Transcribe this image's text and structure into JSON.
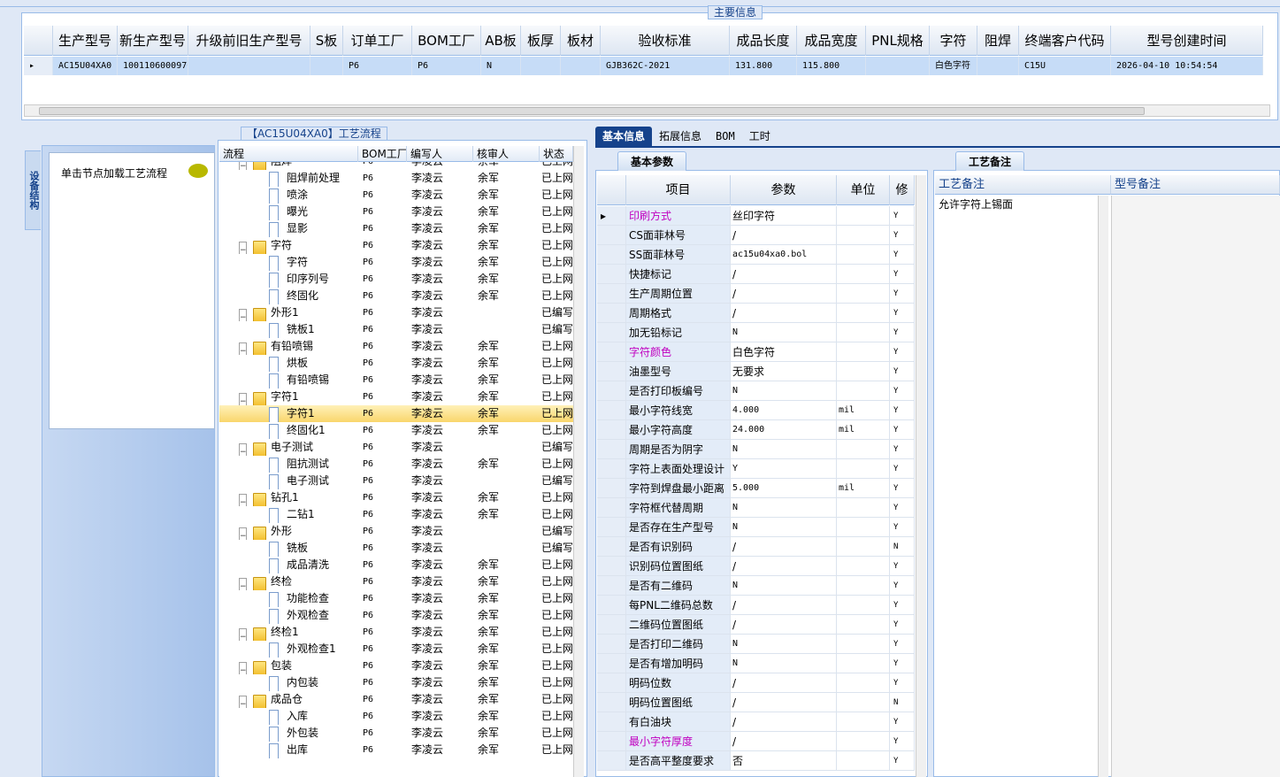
{
  "top": {
    "group_title": "主要信息",
    "columns": [
      "",
      "生产型号",
      "新生产型号",
      "升级前旧生产型号",
      "S板",
      "订单工厂",
      "BOM工厂",
      "AB板",
      "板厚",
      "板材",
      "验收标准",
      "成品长度",
      "成品宽度",
      "PNL规格",
      "字符",
      "阻焊",
      "终端客户代码",
      "型号创建时间"
    ],
    "row": [
      "",
      "AC15U04XA0",
      "10011060009702",
      "",
      "",
      "P6",
      "P6",
      "N",
      "",
      "",
      "GJB362C-2021",
      "131.800",
      "115.800",
      "",
      "白色字符",
      "",
      "C15U",
      "2026-04-10 10:54:54"
    ]
  },
  "left": {
    "vertical_tab": "设备结构",
    "hint": "单击节点加载工艺流程"
  },
  "flow": {
    "title": "【AC15U04XA0】工艺流程",
    "columns": [
      "流程",
      "BOM工厂",
      "编写人",
      "核审人",
      "状态"
    ],
    "rows": [
      {
        "name": "阻焊",
        "type": "folder",
        "level": 1,
        "bom": "P6",
        "author": "李凌云",
        "reviewer": "余军",
        "status": "已上网"
      },
      {
        "name": "阻焊前处理",
        "type": "page",
        "level": 2,
        "bom": "P6",
        "author": "李凌云",
        "reviewer": "余军",
        "status": "已上网"
      },
      {
        "name": "喷涂",
        "type": "page",
        "level": 2,
        "bom": "P6",
        "author": "李凌云",
        "reviewer": "余军",
        "status": "已上网"
      },
      {
        "name": "曝光",
        "type": "page",
        "level": 2,
        "bom": "P6",
        "author": "李凌云",
        "reviewer": "余军",
        "status": "已上网"
      },
      {
        "name": "显影",
        "type": "page",
        "level": 2,
        "bom": "P6",
        "author": "李凌云",
        "reviewer": "余军",
        "status": "已上网"
      },
      {
        "name": "字符",
        "type": "folder",
        "level": 1,
        "bom": "P6",
        "author": "李凌云",
        "reviewer": "余军",
        "status": "已上网"
      },
      {
        "name": "字符",
        "type": "page",
        "level": 2,
        "bom": "P6",
        "author": "李凌云",
        "reviewer": "余军",
        "status": "已上网"
      },
      {
        "name": "印序列号",
        "type": "page",
        "level": 2,
        "bom": "P6",
        "author": "李凌云",
        "reviewer": "余军",
        "status": "已上网"
      },
      {
        "name": "终固化",
        "type": "page",
        "level": 2,
        "bom": "P6",
        "author": "李凌云",
        "reviewer": "余军",
        "status": "已上网"
      },
      {
        "name": "外形1",
        "type": "folder",
        "level": 1,
        "bom": "P6",
        "author": "李凌云",
        "reviewer": "",
        "status": "已编写"
      },
      {
        "name": "铣板1",
        "type": "page",
        "level": 2,
        "bom": "P6",
        "author": "李凌云",
        "reviewer": "",
        "status": "已编写"
      },
      {
        "name": "有铅喷锡",
        "type": "folder",
        "level": 1,
        "bom": "P6",
        "author": "李凌云",
        "reviewer": "余军",
        "status": "已上网"
      },
      {
        "name": "烘板",
        "type": "page",
        "level": 2,
        "bom": "P6",
        "author": "李凌云",
        "reviewer": "余军",
        "status": "已上网"
      },
      {
        "name": "有铅喷锡",
        "type": "page",
        "level": 2,
        "bom": "P6",
        "author": "李凌云",
        "reviewer": "余军",
        "status": "已上网"
      },
      {
        "name": "字符1",
        "type": "folder",
        "level": 1,
        "bom": "P6",
        "author": "李凌云",
        "reviewer": "余军",
        "status": "已上网"
      },
      {
        "name": "字符1",
        "type": "page",
        "level": 2,
        "bom": "P6",
        "author": "李凌云",
        "reviewer": "余军",
        "status": "已上网",
        "selected": true
      },
      {
        "name": "终固化1",
        "type": "page",
        "level": 2,
        "bom": "P6",
        "author": "李凌云",
        "reviewer": "余军",
        "status": "已上网"
      },
      {
        "name": "电子测试",
        "type": "folder",
        "level": 1,
        "bom": "P6",
        "author": "李凌云",
        "reviewer": "",
        "status": "已编写"
      },
      {
        "name": "阻抗测试",
        "type": "page",
        "level": 2,
        "bom": "P6",
        "author": "李凌云",
        "reviewer": "余军",
        "status": "已上网"
      },
      {
        "name": "电子测试",
        "type": "page",
        "level": 2,
        "bom": "P6",
        "author": "李凌云",
        "reviewer": "",
        "status": "已编写"
      },
      {
        "name": "钻孔1",
        "type": "folder",
        "level": 1,
        "bom": "P6",
        "author": "李凌云",
        "reviewer": "余军",
        "status": "已上网"
      },
      {
        "name": "二钻1",
        "type": "page",
        "level": 2,
        "bom": "P6",
        "author": "李凌云",
        "reviewer": "余军",
        "status": "已上网"
      },
      {
        "name": "外形",
        "type": "folder",
        "level": 1,
        "bom": "P6",
        "author": "李凌云",
        "reviewer": "",
        "status": "已编写"
      },
      {
        "name": "铣板",
        "type": "page",
        "level": 2,
        "bom": "P6",
        "author": "李凌云",
        "reviewer": "",
        "status": "已编写"
      },
      {
        "name": "成品清洗",
        "type": "page",
        "level": 2,
        "bom": "P6",
        "author": "李凌云",
        "reviewer": "余军",
        "status": "已上网"
      },
      {
        "name": "终检",
        "type": "folder",
        "level": 1,
        "bom": "P6",
        "author": "李凌云",
        "reviewer": "余军",
        "status": "已上网"
      },
      {
        "name": "功能检查",
        "type": "page",
        "level": 2,
        "bom": "P6",
        "author": "李凌云",
        "reviewer": "余军",
        "status": "已上网"
      },
      {
        "name": "外观检查",
        "type": "page",
        "level": 2,
        "bom": "P6",
        "author": "李凌云",
        "reviewer": "余军",
        "status": "已上网"
      },
      {
        "name": "终检1",
        "type": "folder",
        "level": 1,
        "bom": "P6",
        "author": "李凌云",
        "reviewer": "余军",
        "status": "已上网"
      },
      {
        "name": "外观检查1",
        "type": "page",
        "level": 2,
        "bom": "P6",
        "author": "李凌云",
        "reviewer": "余军",
        "status": "已上网"
      },
      {
        "name": "包装",
        "type": "folder",
        "level": 1,
        "bom": "P6",
        "author": "李凌云",
        "reviewer": "余军",
        "status": "已上网"
      },
      {
        "name": "内包装",
        "type": "page",
        "level": 2,
        "bom": "P6",
        "author": "李凌云",
        "reviewer": "余军",
        "status": "已上网"
      },
      {
        "name": "成品仓",
        "type": "folder",
        "level": 1,
        "bom": "P6",
        "author": "李凌云",
        "reviewer": "余军",
        "status": "已上网"
      },
      {
        "name": "入库",
        "type": "page",
        "level": 2,
        "bom": "P6",
        "author": "李凌云",
        "reviewer": "余军",
        "status": "已上网"
      },
      {
        "name": "外包装",
        "type": "page",
        "level": 2,
        "bom": "P6",
        "author": "李凌云",
        "reviewer": "余军",
        "status": "已上网"
      },
      {
        "name": "出库",
        "type": "page",
        "level": 2,
        "bom": "P6",
        "author": "李凌云",
        "reviewer": "余军",
        "status": "已上网"
      }
    ]
  },
  "tabs": [
    "基本信息",
    "拓展信息",
    "BOM",
    "工时"
  ],
  "params": {
    "subtab": "基本参数",
    "columns": [
      "",
      "项目",
      "参数",
      "单位",
      "修"
    ],
    "rows": [
      {
        "item": "印刷方式",
        "value": "丝印字符",
        "unit": "",
        "flag": "Y",
        "hl": true
      },
      {
        "item": "CS面菲林号",
        "value": "/",
        "unit": "",
        "flag": "Y"
      },
      {
        "item": "SS面菲林号",
        "value": "ac15u04xa0.bol",
        "unit": "",
        "flag": "Y",
        "mono": true
      },
      {
        "item": "快捷标记",
        "value": "/",
        "unit": "",
        "flag": "Y"
      },
      {
        "item": "生产周期位置",
        "value": "/",
        "unit": "",
        "flag": "Y"
      },
      {
        "item": "周期格式",
        "value": "/",
        "unit": "",
        "flag": "Y"
      },
      {
        "item": "加无铅标记",
        "value": "N",
        "unit": "",
        "flag": "Y",
        "mono": true
      },
      {
        "item": "字符颜色",
        "value": "白色字符",
        "unit": "",
        "flag": "Y",
        "hl": true
      },
      {
        "item": "油墨型号",
        "value": "无要求",
        "unit": "",
        "flag": "Y"
      },
      {
        "item": "是否打印板编号",
        "value": "N",
        "unit": "",
        "flag": "Y",
        "mono": true
      },
      {
        "item": "最小字符线宽",
        "value": "4.000",
        "unit": "mil",
        "flag": "Y",
        "mono": true
      },
      {
        "item": "最小字符高度",
        "value": "24.000",
        "unit": "mil",
        "flag": "Y",
        "mono": true
      },
      {
        "item": "周期是否为阴字",
        "value": "N",
        "unit": "",
        "flag": "Y",
        "mono": true
      },
      {
        "item": "字符上表面处理设计",
        "value": "Y",
        "unit": "",
        "flag": "Y",
        "mono": true
      },
      {
        "item": "字符到焊盘最小距离",
        "value": "5.000",
        "unit": "mil",
        "flag": "Y",
        "mono": true
      },
      {
        "item": "字符框代替周期",
        "value": "N",
        "unit": "",
        "flag": "Y",
        "mono": true
      },
      {
        "item": "是否存在生产型号",
        "value": "N",
        "unit": "",
        "flag": "Y",
        "mono": true
      },
      {
        "item": "是否有识别码",
        "value": "/",
        "unit": "",
        "flag": "N"
      },
      {
        "item": "识别码位置图纸",
        "value": "/",
        "unit": "",
        "flag": "Y"
      },
      {
        "item": "是否有二维码",
        "value": "N",
        "unit": "",
        "flag": "Y",
        "mono": true
      },
      {
        "item": "每PNL二维码总数",
        "value": "/",
        "unit": "",
        "flag": "Y"
      },
      {
        "item": "二维码位置图纸",
        "value": "/",
        "unit": "",
        "flag": "Y"
      },
      {
        "item": "是否打印二维码",
        "value": "N",
        "unit": "",
        "flag": "Y",
        "mono": true
      },
      {
        "item": "是否有增加明码",
        "value": "N",
        "unit": "",
        "flag": "Y",
        "mono": true
      },
      {
        "item": "明码位数",
        "value": "/",
        "unit": "",
        "flag": "Y"
      },
      {
        "item": "明码位置图纸",
        "value": "/",
        "unit": "",
        "flag": "N"
      },
      {
        "item": "有白油块",
        "value": "/",
        "unit": "",
        "flag": "Y"
      },
      {
        "item": "最小字符厚度",
        "value": "/",
        "unit": "",
        "flag": "Y",
        "hl": true
      },
      {
        "item": "是否高平整度要求",
        "value": "否",
        "unit": "",
        "flag": "Y"
      }
    ]
  },
  "notes": {
    "tab": "工艺备注",
    "col1": "工艺备注",
    "col2": "型号备注",
    "text": "允许字符上锡面"
  }
}
